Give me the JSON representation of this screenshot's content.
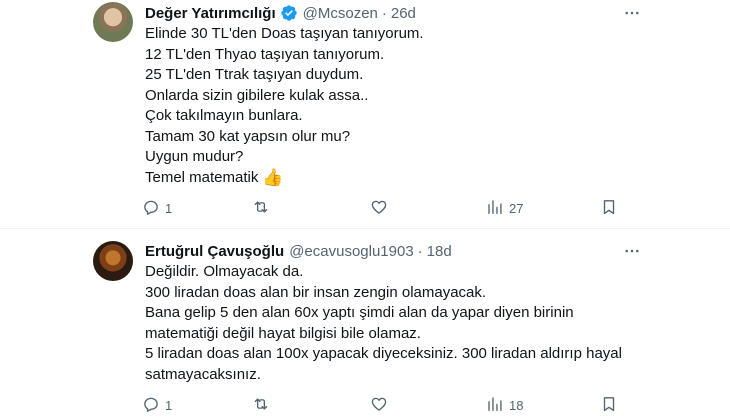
{
  "tweets": [
    {
      "name": "Değer Yatırımcılığı",
      "verified": true,
      "handle": "@Mcsozen",
      "separator": "·",
      "time": "26d",
      "lines": [
        "Elinde 30 TL'den Doas taşıyan tanıyorum.",
        "12 TL'den Thyao taşıyan tanıyorum.",
        "25 TL'den Ttrak taşıyan duydum.",
        "Onlarda sizin gibilere kulak assa..",
        "Çok takılmayın bunlara.",
        "Tamam 30 kat yapsın olur mu?",
        "Uygun mudur?",
        "Temel matematik"
      ],
      "emoji": "👍",
      "replies": "1",
      "retweets": "",
      "likes": "",
      "views": "27"
    },
    {
      "name": "Ertuğrul Çavuşoğlu",
      "verified": false,
      "handle": "@ecavusoglu1903",
      "separator": "·",
      "time": "18d",
      "lines": [
        "Değildir. Olmayacak da.",
        "300 liradan doas alan bir insan zengin olamayacak.",
        "Bana gelip 5 den alan 60x yaptı şimdi alan da yapar diyen birinin",
        "matematiği değil hayat bilgisi bile olamaz.",
        "5 liradan doas alan 100x yapacak diyeceksiniz. 300 liradan aldırıp hayal",
        "satmayacaksınız."
      ],
      "replies": "1",
      "retweets": "",
      "likes": "",
      "views": "18"
    }
  ],
  "colors": {
    "text": "#0f1419",
    "secondary": "#536471",
    "verified": "#1d9bf0",
    "divider": "#eff3f4"
  },
  "icons": [
    "verified-badge-icon",
    "more-icon",
    "reply-icon",
    "retweet-icon",
    "like-icon",
    "views-icon",
    "bookmark-icon"
  ]
}
